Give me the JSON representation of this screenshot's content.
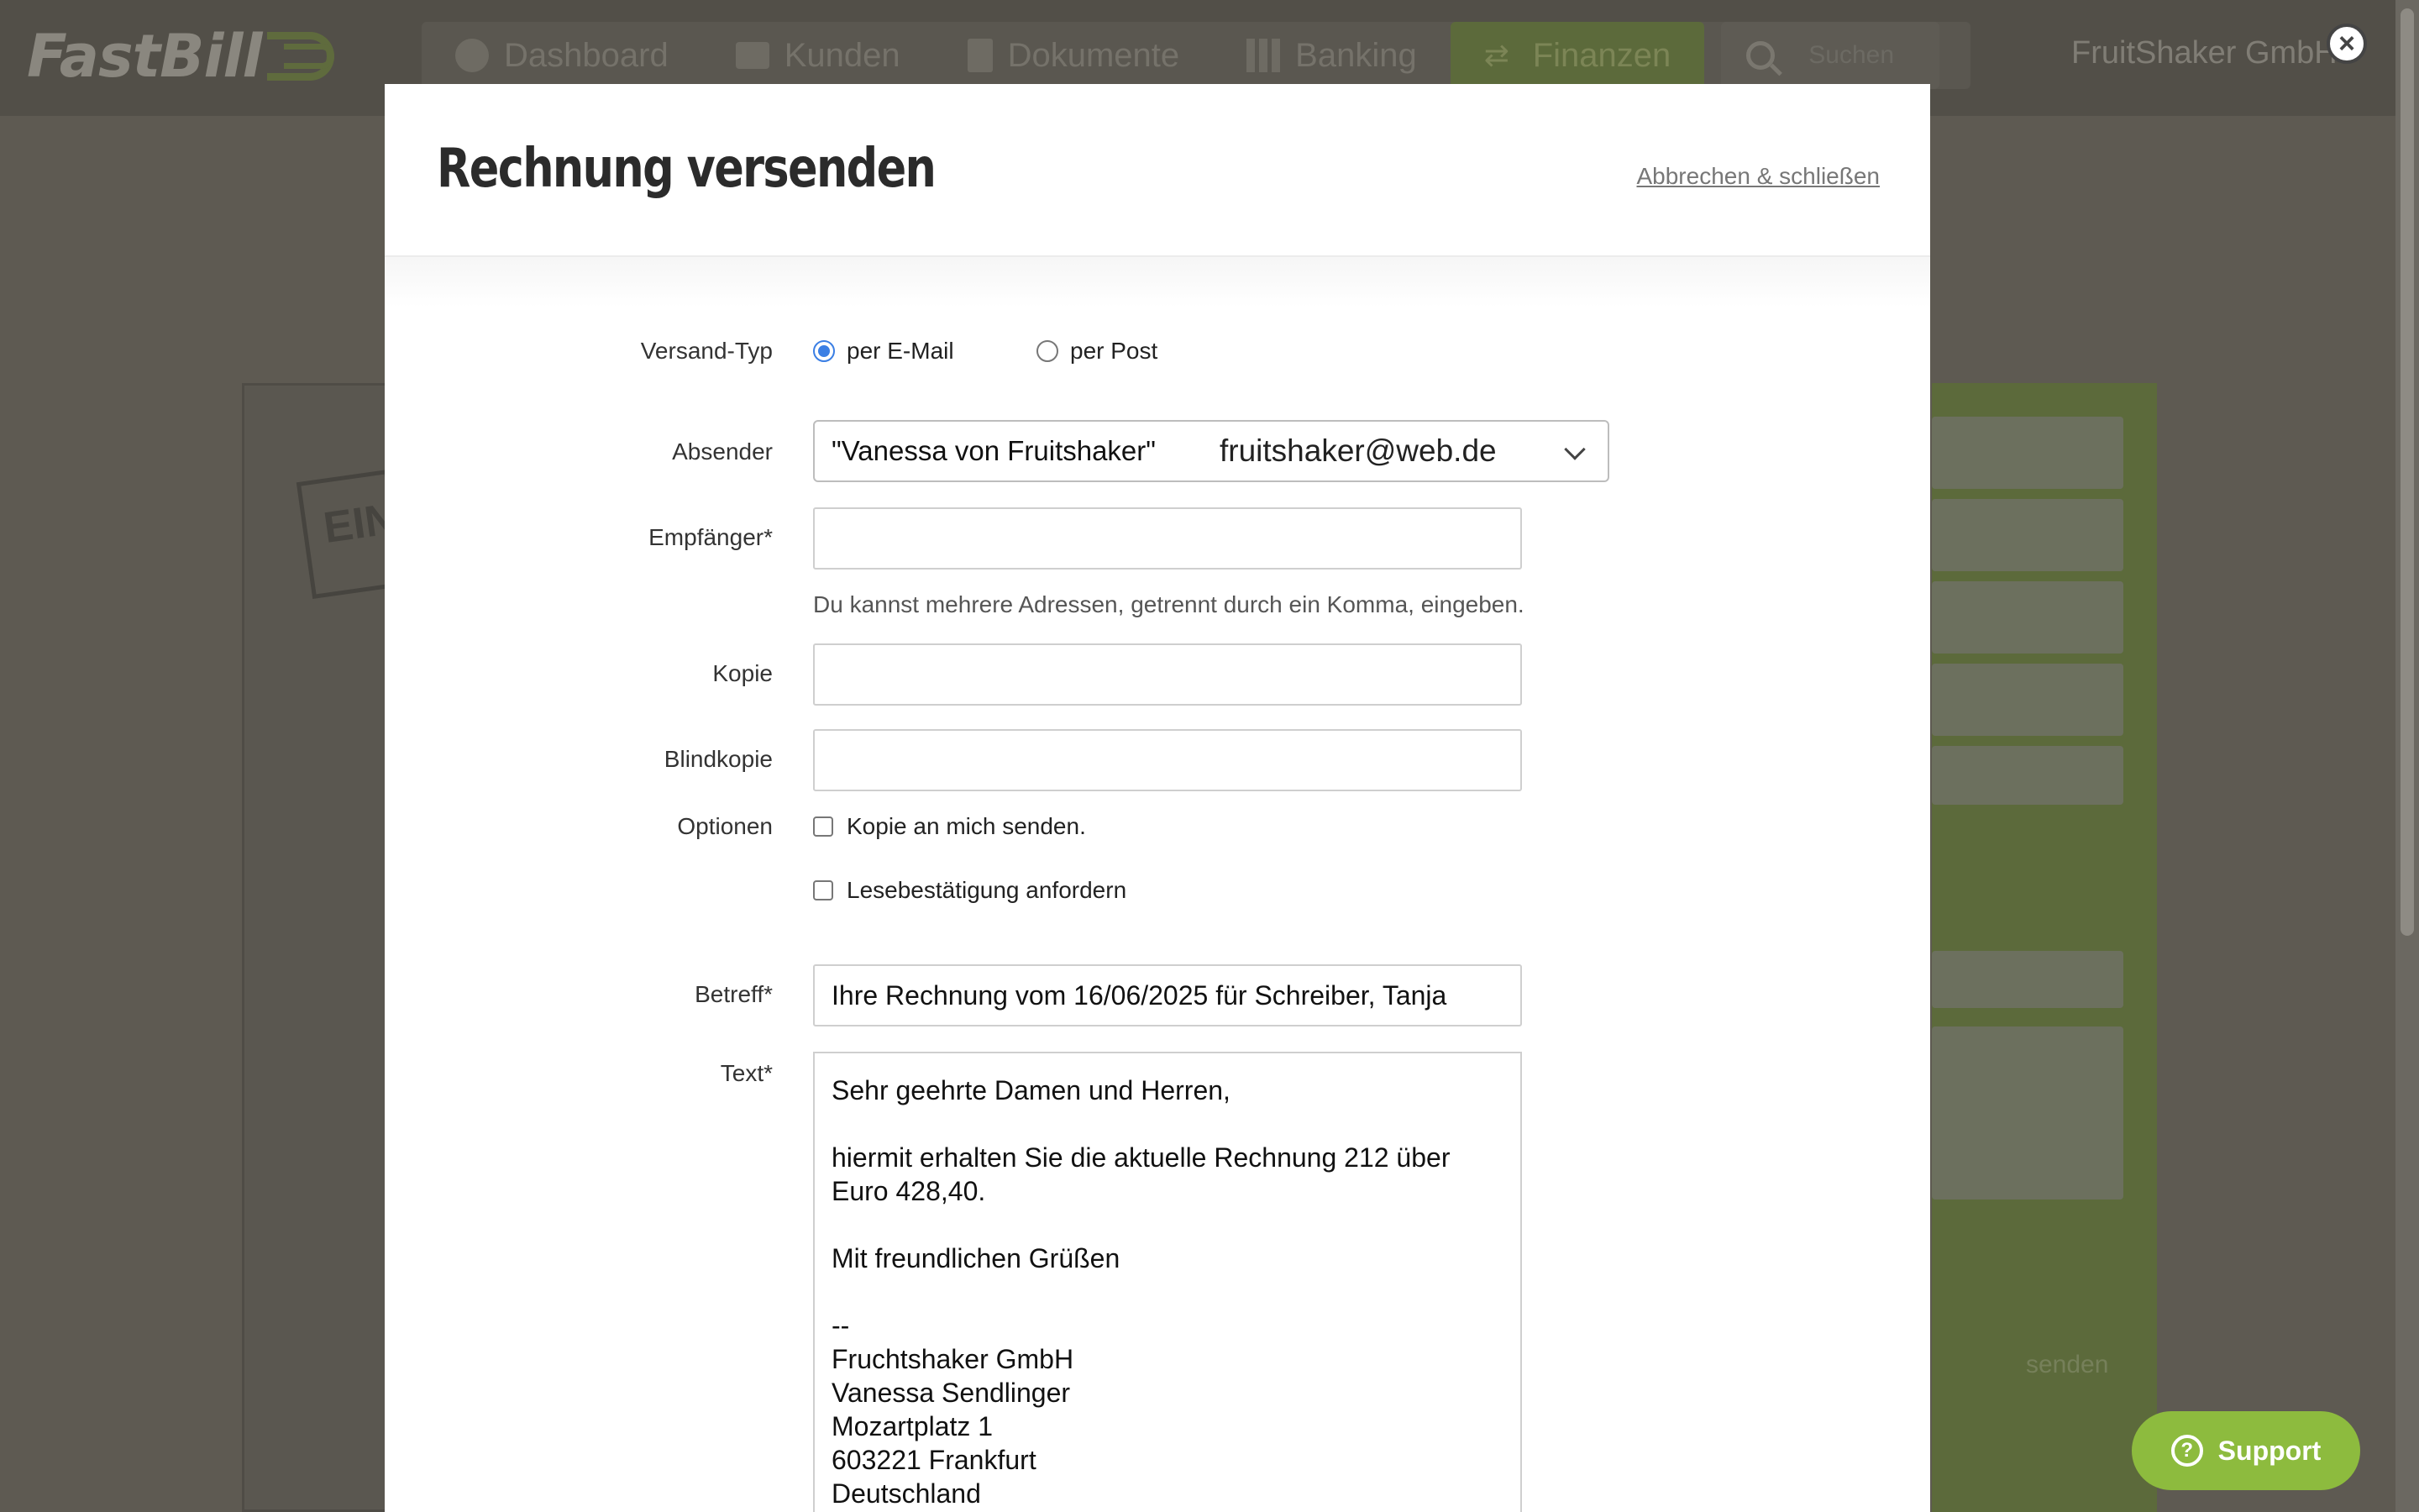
{
  "app": {
    "logo": "FastBill",
    "company": "FruitShaker GmbH",
    "nav": [
      {
        "label": "Dashboard",
        "icon": "dashboard-icon"
      },
      {
        "label": "Kunden",
        "icon": "briefcase-icon"
      },
      {
        "label": "Dokumente",
        "icon": "document-icon"
      },
      {
        "label": "Banking",
        "icon": "bar-chart-icon"
      },
      {
        "label": "Finanzen",
        "icon": "transfer-icon",
        "active": true
      }
    ],
    "search_placeholder": "Suchen",
    "doc_stamp": "EIN",
    "background_action": "senden",
    "support_label": "Support"
  },
  "modal": {
    "title": "Rechnung versenden",
    "close_link": "Abbrechen & schließen",
    "versand_typ": {
      "label": "Versand-Typ",
      "options": [
        {
          "label": "per E-Mail",
          "checked": true
        },
        {
          "label": "per Post",
          "checked": false
        }
      ]
    },
    "absender": {
      "label": "Absender",
      "name": "\"Vanessa von Fruitshaker\"",
      "email": "fruitshaker@web.de"
    },
    "empfaenger": {
      "label": "Empfänger*",
      "value": "",
      "hint": "Du kannst mehrere Adressen, getrennt durch ein Komma, eingeben."
    },
    "kopie": {
      "label": "Kopie",
      "value": ""
    },
    "blindkopie": {
      "label": "Blindkopie",
      "value": ""
    },
    "optionen": {
      "label": "Optionen",
      "items": [
        {
          "label": "Kopie an mich senden.",
          "checked": false
        },
        {
          "label": "Lesebestätigung anfordern",
          "checked": false
        }
      ]
    },
    "betreff": {
      "label": "Betreff*",
      "value": "Ihre Rechnung vom 16/06/2025 für Schreiber, Tanja"
    },
    "text": {
      "label": "Text*",
      "value": "Sehr geehrte Damen und Herren,\n\nhiermit erhalten Sie die aktuelle Rechnung 212 über\nEuro 428,40.\n\nMit freundlichen Grüßen\n\n--\nFruchtshaker GmbH\nVanessa Sendlinger\nMozartplatz 1\n603221 Frankfurt\nDeutschland"
    }
  },
  "colors": {
    "accent": "#8dbb3e",
    "radio": "#3b7fe4",
    "overlay": "#5e5a52"
  }
}
